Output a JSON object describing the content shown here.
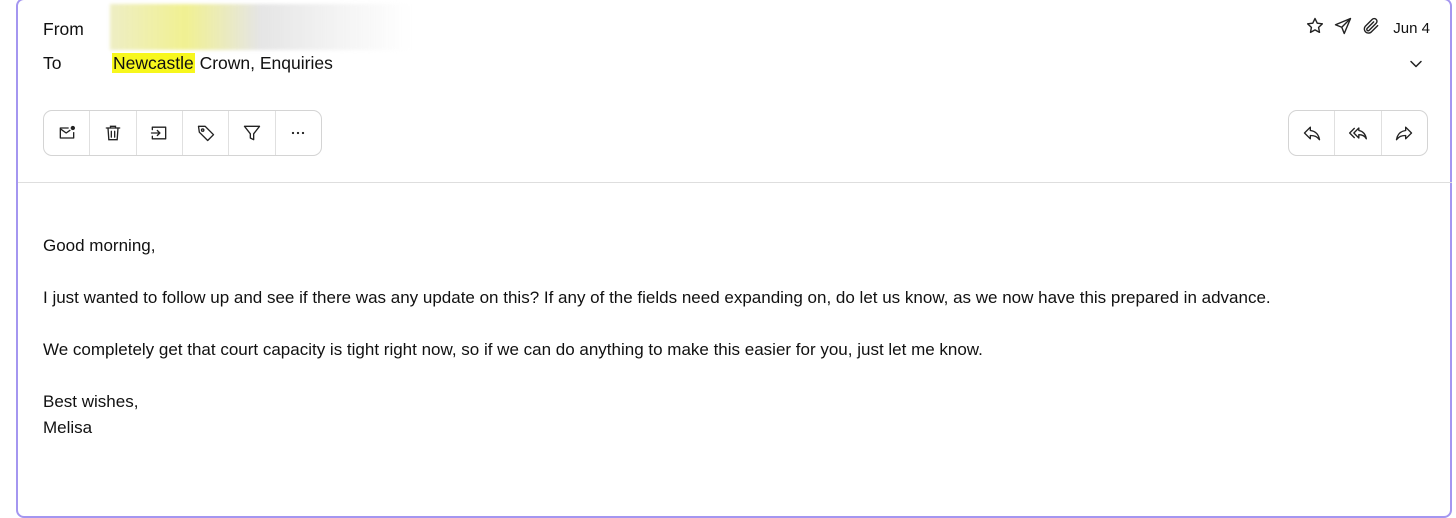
{
  "header": {
    "from_label": "From",
    "to_label": "To",
    "to_highlight": "Newcastle",
    "to_rest": " Crown, Enquiries",
    "date": "Jun 4"
  },
  "icons": {
    "meta": [
      "star-icon",
      "send-icon",
      "paperclip-icon"
    ],
    "toolbar_left": [
      "mark-unread-icon",
      "trash-icon",
      "move-to-icon",
      "tag-icon",
      "filter-icon",
      "more-icon"
    ],
    "toolbar_right": [
      "reply-icon",
      "reply-all-icon",
      "forward-icon"
    ]
  },
  "colors": {
    "highlight": "#f7f71d",
    "frame_border": "#a496f0"
  },
  "message": {
    "greeting": "Good morning,",
    "para1": "I just wanted to follow up and see if there was any update on this? If any of the fields need expanding on, do let us know, as we now have this prepared in advance.",
    "para2": "We completely get that court capacity is tight right now, so if we can do anything to make this easier for you, just let me know.",
    "signoff": "Best wishes,",
    "signature": "Melisa"
  }
}
